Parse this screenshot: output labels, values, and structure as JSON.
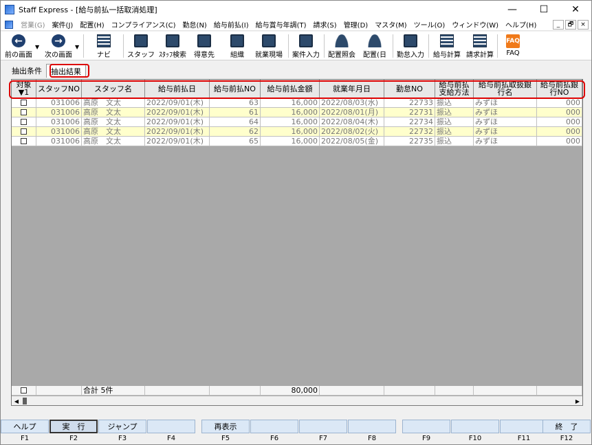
{
  "window": {
    "title": "Staff Express - [給与前払一括取消処理]",
    "controls": [
      "—",
      "☐",
      "✕"
    ]
  },
  "menu": {
    "items": [
      {
        "label": "営業(G)",
        "disabled": true
      },
      {
        "label": "案件(J)"
      },
      {
        "label": "配置(H)"
      },
      {
        "label": "コンプライアンス(C)"
      },
      {
        "label": "勤怠(N)"
      },
      {
        "label": "給与前払(I)"
      },
      {
        "label": "給与賞与年調(T)"
      },
      {
        "label": "請求(S)"
      },
      {
        "label": "管理(D)"
      },
      {
        "label": "マスタ(M)"
      },
      {
        "label": "ツール(O)"
      },
      {
        "label": "ウィンドウ(W)"
      },
      {
        "label": "ヘルプ(H)"
      }
    ],
    "mdi": [
      "_",
      "🗗",
      "×"
    ]
  },
  "toolbar": {
    "items": [
      {
        "label": "前の画面",
        "icon": "back-icon"
      },
      {
        "label": "次の画面",
        "icon": "forward-icon"
      },
      {
        "label": "ナビ",
        "icon": "navi-icon"
      },
      {
        "label": "スタッフ",
        "icon": "staff-icon"
      },
      {
        "label": "ｽﾀｯﾌ検索",
        "icon": "staff-search-icon"
      },
      {
        "label": "得意先",
        "icon": "client-icon"
      },
      {
        "label": "組織",
        "icon": "organization-icon"
      },
      {
        "label": "就業現場",
        "icon": "worksite-icon"
      },
      {
        "label": "案件入力",
        "icon": "job-entry-icon"
      },
      {
        "label": "配置照会",
        "icon": "placement-inquiry-icon"
      },
      {
        "label": "配置(日",
        "icon": "placement-daily-icon"
      },
      {
        "label": "勤怠入力",
        "icon": "attendance-entry-icon"
      },
      {
        "label": "給与計算",
        "icon": "payroll-icon"
      },
      {
        "label": "請求計算",
        "icon": "billing-icon"
      },
      {
        "label": "FAQ",
        "icon": "faq-icon"
      }
    ]
  },
  "tabs": [
    {
      "label": "抽出条件"
    },
    {
      "label": "抽出結果",
      "active": true
    }
  ],
  "grid": {
    "headers": [
      "対象\n▼1",
      "スタッフNO",
      "スタッフ名",
      "給与前払日",
      "給与前払NO",
      "給与前払金額",
      "就業年月日",
      "勤怠NO",
      "給与前払\n支給方法",
      "給与前払取扱銀\n行名",
      "給与前払銀\n行NO"
    ],
    "rows": [
      [
        "",
        "031006",
        "高原　文太",
        "2022/09/01(木)",
        "63",
        "16,000",
        "2022/08/03(水)",
        "22733",
        "振込",
        "みずほ",
        "000"
      ],
      [
        "",
        "031006",
        "高原　文太",
        "2022/09/01(木)",
        "61",
        "16,000",
        "2022/08/01(月)",
        "22731",
        "振込",
        "みずほ",
        "000"
      ],
      [
        "",
        "031006",
        "高原　文太",
        "2022/09/01(木)",
        "64",
        "16,000",
        "2022/08/04(木)",
        "22734",
        "振込",
        "みずほ",
        "000"
      ],
      [
        "",
        "031006",
        "高原　文太",
        "2022/09/01(木)",
        "62",
        "16,000",
        "2022/08/02(火)",
        "22732",
        "振込",
        "みずほ",
        "000"
      ],
      [
        "",
        "031006",
        "高原　文太",
        "2022/09/01(木)",
        "65",
        "16,000",
        "2022/08/05(金)",
        "22735",
        "振込",
        "みずほ",
        "000"
      ]
    ],
    "total": {
      "label": "合計 5件",
      "amount": "80,000"
    }
  },
  "fkeys": [
    {
      "label": "ヘルプ",
      "key": "F1"
    },
    {
      "label": "実　行",
      "key": "F2",
      "pressed": true
    },
    {
      "label": "ジャンプ",
      "key": "F3"
    },
    {
      "label": "",
      "key": "F4"
    },
    {
      "label": "再表示",
      "key": "F5"
    },
    {
      "label": "",
      "key": "F6"
    },
    {
      "label": "",
      "key": "F7"
    },
    {
      "label": "",
      "key": "F8"
    },
    {
      "label": "",
      "key": "F9"
    },
    {
      "label": "",
      "key": "F10"
    },
    {
      "label": "",
      "key": "F11"
    },
    {
      "label": "終　了",
      "key": "F12"
    }
  ]
}
